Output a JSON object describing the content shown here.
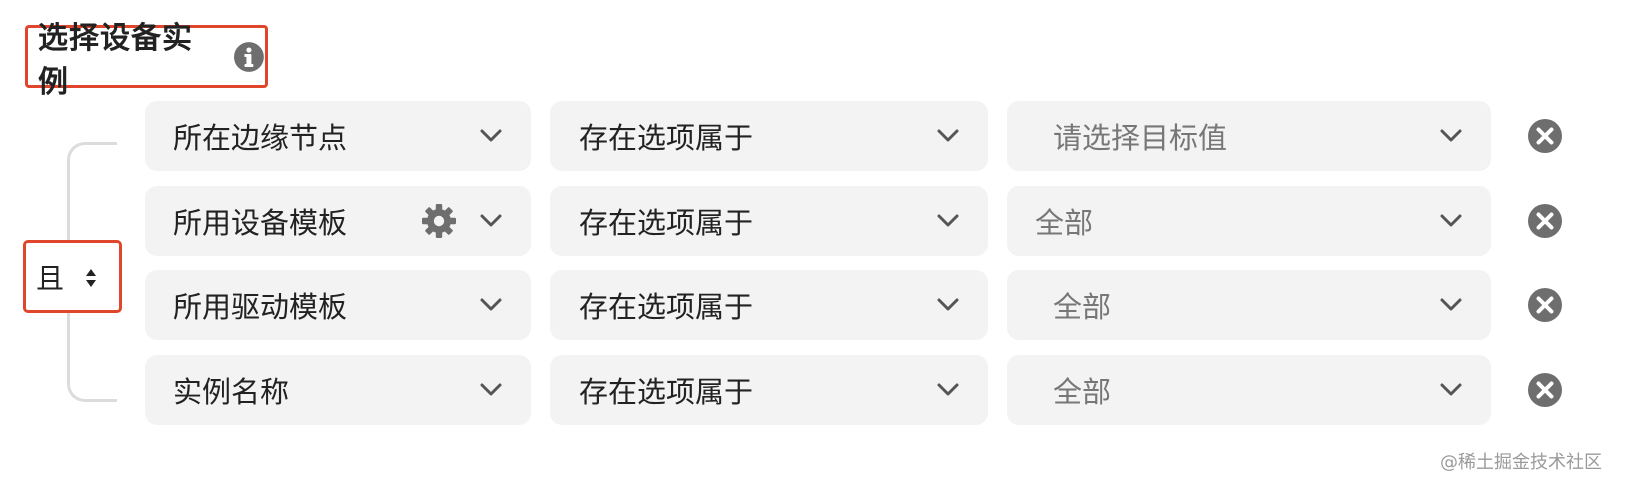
{
  "section": {
    "title": "选择设备实例",
    "info_icon": "info-circle-icon"
  },
  "logic": {
    "operator": "且",
    "icon": "sort-arrows-icon"
  },
  "conditions": [
    {
      "field": "所在边缘节点",
      "operator": "存在选项属于",
      "value": "",
      "value_placeholder": "请选择目标值",
      "has_gear": false
    },
    {
      "field": "所用设备模板",
      "operator": "存在选项属于",
      "value": "全部",
      "value_placeholder": "",
      "has_gear": true
    },
    {
      "field": "所用驱动模板",
      "operator": "存在选项属于",
      "value": "全部",
      "value_placeholder": "",
      "has_gear": false
    },
    {
      "field": "实例名称",
      "operator": "存在选项属于",
      "value": "全部",
      "value_placeholder": "",
      "has_gear": false
    }
  ],
  "icons": {
    "chevron": "chevron-down-icon",
    "gear": "gear-icon",
    "remove": "close-circle-icon"
  },
  "watermark": "@稀土掘金技术社区",
  "colors": {
    "highlight_border": "#e0462c",
    "select_bg": "#f3f3f3",
    "icon_gray": "#6e6e6e",
    "bracket": "#dcdcdc"
  }
}
